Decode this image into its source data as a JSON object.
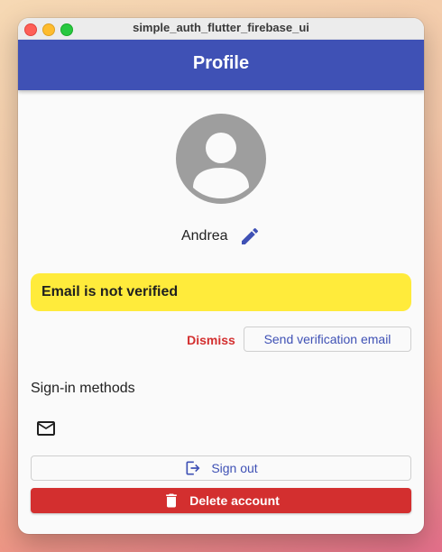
{
  "window": {
    "title": "simple_auth_flutter_firebase_ui"
  },
  "appbar": {
    "title": "Profile"
  },
  "profile": {
    "display_name": "Andrea",
    "avatar_icon": "person-icon",
    "edit_icon": "pencil-icon"
  },
  "verification": {
    "banner_text": "Email is not verified",
    "dismiss_label": "Dismiss",
    "send_label": "Send verification email"
  },
  "sign_in_methods": {
    "title": "Sign-in methods",
    "providers": [
      {
        "icon": "email-icon"
      }
    ]
  },
  "actions": {
    "sign_out_label": "Sign out",
    "sign_out_icon": "logout-icon",
    "delete_label": "Delete account",
    "delete_icon": "trash-icon"
  },
  "colors": {
    "primary": "#3f51b5",
    "warning": "#ffeb3b",
    "danger": "#d32f2f",
    "avatar_gray": "#9e9e9e"
  }
}
